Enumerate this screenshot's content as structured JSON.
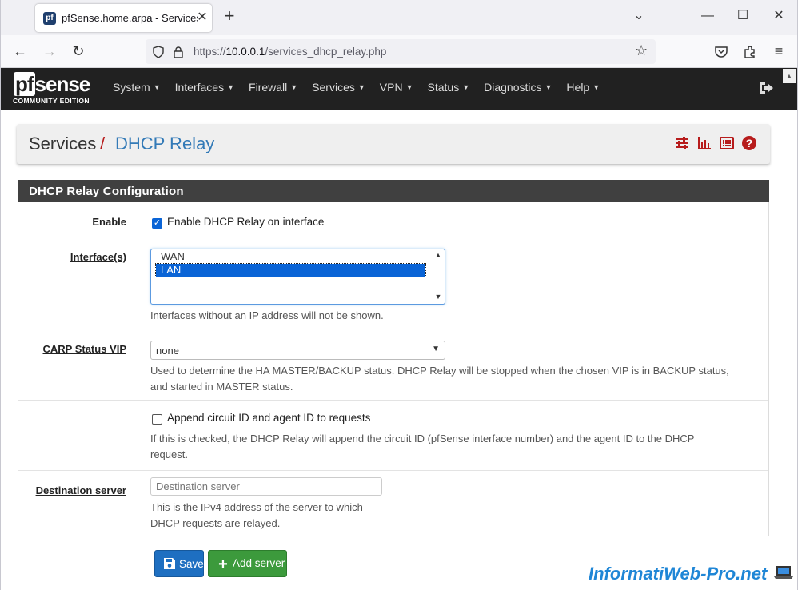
{
  "browser": {
    "tab_title": "pfSense.home.arpa - Services: D",
    "url_prefix": "https://",
    "url_host": "10.0.0.1",
    "url_path": "/services_dhcp_relay.php"
  },
  "app": {
    "logo_text": "pfsense",
    "logo_subtitle": "COMMUNITY EDITION",
    "menu": [
      "System",
      "Interfaces",
      "Firewall",
      "Services",
      "VPN",
      "Status",
      "Diagnostics",
      "Help"
    ]
  },
  "breadcrumb": {
    "section": "Services",
    "separator": "/",
    "page": "DHCP Relay"
  },
  "panel": {
    "title": "DHCP Relay Configuration",
    "enable": {
      "label": "Enable",
      "checkbox_label": "Enable DHCP Relay on interface",
      "checked": true
    },
    "interfaces": {
      "label": "Interface(s)",
      "options": [
        "WAN",
        "LAN"
      ],
      "selected": "LAN",
      "help": "Interfaces without an IP address will not be shown."
    },
    "carp": {
      "label": "CARP Status VIP",
      "value": "none",
      "help_line1": "Used to determine the HA MASTER/BACKUP status. DHCP Relay will be stopped when the chosen VIP is in BACKUP status,",
      "help_line2": "and started in MASTER status."
    },
    "append": {
      "checkbox_label": "Append circuit ID and agent ID to requests",
      "checked": false,
      "help_line1": "If this is checked, the DHCP Relay will append the circuit ID (pfSense interface number) and the agent ID to the DHCP",
      "help_line2": "request."
    },
    "destination": {
      "label": "Destination server",
      "placeholder": "Destination server",
      "help_line1": "This is the IPv4 address of the server to which",
      "help_line2": "DHCP requests are relayed."
    }
  },
  "actions": {
    "save_label": "Save",
    "add_server_label": "Add server"
  },
  "watermark": "InformatiWeb-Pro.net",
  "colors": {
    "accent_red": "#b71c1c",
    "link_blue": "#337ab7",
    "save_blue": "#1e6fc1",
    "add_green": "#3c9a3c",
    "nav_dark": "#212121"
  }
}
